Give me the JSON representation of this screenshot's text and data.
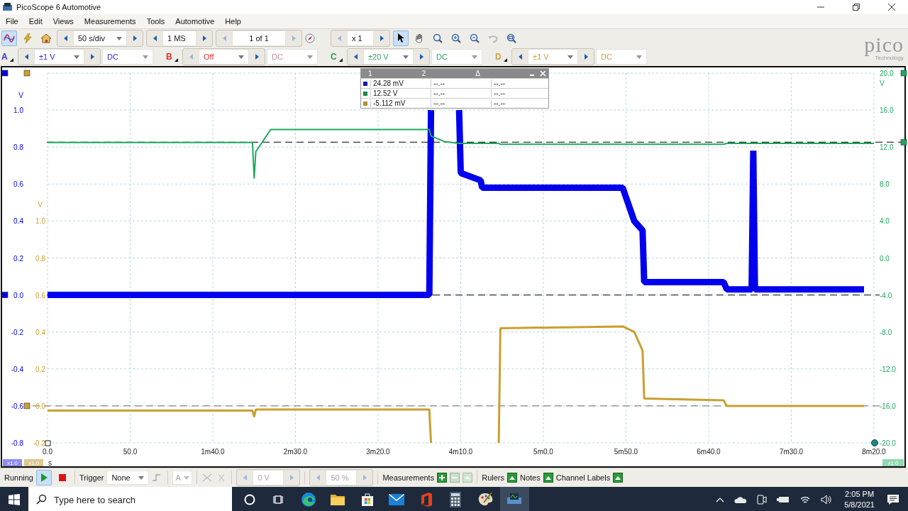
{
  "window": {
    "title": "PicoScope 6 Automotive"
  },
  "menu": [
    "File",
    "Edit",
    "Views",
    "Measurements",
    "Tools",
    "Automotive",
    "Help"
  ],
  "modes": [
    {
      "kind": "scope",
      "selected": true
    },
    {
      "kind": "probe",
      "selected": false
    },
    {
      "kind": "home",
      "selected": false
    }
  ],
  "toolbar": {
    "timebase": "50 s/div",
    "samples": "1 MS",
    "buffer": "1 of 1",
    "zoom": "x 1"
  },
  "tools": [
    {
      "kind": "pointer",
      "selected": true
    },
    {
      "kind": "hand",
      "selected": false
    },
    {
      "kind": "zoom-region",
      "selected": false
    },
    {
      "kind": "zoom-in",
      "selected": false
    },
    {
      "kind": "zoom-out",
      "selected": false
    },
    {
      "kind": "undo",
      "selected": false
    },
    {
      "kind": "zoom-fit",
      "selected": false
    }
  ],
  "channels": [
    {
      "letter": "A",
      "range": "±1 V",
      "coupling": "DC",
      "enabled": true,
      "color": "#2e2ed0"
    },
    {
      "letter": "B",
      "range": "Off",
      "coupling": "DC",
      "enabled": false,
      "color": "#e03030"
    },
    {
      "letter": "C",
      "range": "±20 V",
      "coupling": "DC",
      "enabled": true,
      "color": "#2aa060"
    },
    {
      "letter": "D",
      "range": "±1 V",
      "coupling": "DC",
      "enabled": true,
      "color": "#c9a440"
    }
  ],
  "logo": {
    "name": "pico",
    "tagline": "Technology"
  },
  "scope": {
    "chart_data": {
      "type": "line",
      "xlabel": "s",
      "ylabel": "V",
      "y2label": "V",
      "y3label": "V",
      "xlim": [
        0,
        500
      ],
      "ylim": [
        -0.8,
        1.2
      ],
      "y2lim": [
        -20,
        20
      ],
      "y3lim": [
        -0.2,
        1.8
      ],
      "x": [
        0,
        124,
        125,
        126,
        135,
        231,
        232,
        240,
        249,
        250,
        262,
        263,
        273,
        274,
        348,
        355,
        360,
        361,
        409,
        411,
        426,
        427,
        428,
        494,
        500
      ],
      "series": [
        {
          "color": "#0000ee",
          "values": [
            0,
            0,
            0,
            0,
            0,
            0,
            1.0,
            null,
            1.0,
            0.66,
            0.62,
            0.58,
            0.58,
            0.58,
            0.58,
            0.4,
            0.35,
            0.07,
            0.07,
            0.03,
            0.03,
            0.78,
            0.03,
            0.03,
            null
          ]
        },
        {
          "color": "#1ea860",
          "axis": "y2",
          "values": [
            12.5,
            12.5,
            8.6,
            11.5,
            13.9,
            13.9,
            13.2,
            12.6,
            12.4,
            12.4,
            12.4,
            12.4,
            12.4,
            12.3,
            12.3,
            12.3,
            12.3,
            12.3,
            12.3,
            12.4,
            12.4,
            12.4,
            12.4,
            12.4,
            12.4
          ]
        },
        {
          "color": "#c8a030",
          "axis": "y3",
          "values": [
            -0.025,
            -0.025,
            -0.06,
            -0.02,
            -0.02,
            -0.02,
            -0.2,
            null,
            null,
            null,
            null,
            null,
            -0.2,
            0.42,
            0.43,
            0.4,
            0.3,
            0.04,
            0.03,
            0.0,
            0.0,
            0.0,
            0.0,
            0.0,
            null
          ]
        }
      ],
      "xticks": [
        {
          "value": 0,
          "label": "0.0"
        },
        {
          "value": 50,
          "label": "50.0"
        },
        {
          "value": 100,
          "label": "1m40.0"
        },
        {
          "value": 150,
          "label": "2m30.0"
        },
        {
          "value": 200,
          "label": "3m20.0"
        },
        {
          "value": 250,
          "label": "4m10.0"
        },
        {
          "value": 300,
          "label": "5m0.0"
        },
        {
          "value": 350,
          "label": "5m50.0"
        },
        {
          "value": 400,
          "label": "6m40.0"
        },
        {
          "value": 450,
          "label": "7m30.0"
        },
        {
          "value": 500,
          "label": "8m20.0"
        }
      ],
      "yticks": [
        {
          "value": 1.0,
          "label": "1.0"
        },
        {
          "value": 0.8,
          "label": "0.8"
        },
        {
          "value": 0.6,
          "label": "0.6"
        },
        {
          "value": 0.4,
          "label": "0.4"
        },
        {
          "value": 0.2,
          "label": "0.2"
        },
        {
          "value": 0,
          "label": "0.0"
        },
        {
          "value": -0.2,
          "label": "-0.2"
        },
        {
          "value": -0.4,
          "label": "-0.4"
        },
        {
          "value": -0.6,
          "label": "-0.6"
        },
        {
          "value": -0.8,
          "label": "-0.8"
        }
      ],
      "y3ticks": [
        {
          "value": 1.0,
          "label": "1.0"
        },
        {
          "value": 0.8,
          "label": "0.8"
        },
        {
          "value": 0.6,
          "label": "0.6"
        },
        {
          "value": 0.4,
          "label": "0.4"
        },
        {
          "value": 0.2,
          "label": "0.2"
        },
        {
          "value": 0,
          "label": "0.0"
        },
        {
          "value": -0.2,
          "label": "-0.2"
        }
      ],
      "y2ticks": [
        {
          "value": 20,
          "label": "20.0"
        },
        {
          "value": 16,
          "label": "16.0"
        },
        {
          "value": 12,
          "label": "12.0"
        },
        {
          "value": 8,
          "label": "8.0"
        },
        {
          "value": 4,
          "label": "4.0"
        },
        {
          "value": 0,
          "label": "0.0"
        },
        {
          "value": -4,
          "label": "-4.0"
        },
        {
          "value": -8,
          "label": "-8.0"
        },
        {
          "value": -12,
          "label": "-12.0"
        },
        {
          "value": -16,
          "label": "-16.0"
        },
        {
          "value": -20,
          "label": "-20.0"
        }
      ],
      "grid": true,
      "ref_lines": [
        {
          "value": 0,
          "axis": "y"
        },
        {
          "value": 12.52,
          "axis": "y2"
        },
        {
          "value": 0,
          "axis": "y3"
        }
      ]
    },
    "scale_badges": [
      {
        "text": "x1.0",
        "color": "#8c8cf0"
      },
      {
        "text": "x1.0",
        "color": "#dcc890"
      },
      {
        "text": "x1.0",
        "color": "#90d8b0"
      }
    ],
    "measurements": {
      "columns": [
        "1",
        "2",
        "Δ"
      ],
      "rows": [
        {
          "color": "#1a1aa0",
          "values": [
            "24.28 mV",
            "--.--",
            "--.--"
          ]
        },
        {
          "color": "#1a8a50",
          "values": [
            "12.52 V",
            "--.--",
            "--.--"
          ]
        },
        {
          "color": "#b09030",
          "values": [
            "-5.112 mV",
            "--.--",
            "--.--"
          ]
        }
      ]
    }
  },
  "status_bar": {
    "state": "Running",
    "running": true,
    "trigger_label": "Trigger",
    "trigger_mode": "None",
    "trigger_source": "A",
    "threshold": "0 V",
    "pre_trigger": "50 %",
    "measurements": "Measurements",
    "rulers": "Rulers",
    "notes": "Notes",
    "channel_labels": "Channel Labels"
  },
  "taskbar": {
    "search_placeholder": "Type here to search",
    "apps": [
      {
        "kind": "cortana",
        "selected": false
      },
      {
        "kind": "task-view",
        "selected": false
      },
      {
        "kind": "edge",
        "selected": false
      },
      {
        "kind": "explorer",
        "selected": false
      },
      {
        "kind": "store",
        "selected": false
      },
      {
        "kind": "mail",
        "selected": false
      },
      {
        "kind": "office",
        "selected": false
      },
      {
        "kind": "calculator",
        "selected": false
      },
      {
        "kind": "paint",
        "selected": false
      },
      {
        "kind": "picoscope",
        "selected": true
      }
    ],
    "time": "2:05 PM",
    "date": "5/8/2021"
  }
}
